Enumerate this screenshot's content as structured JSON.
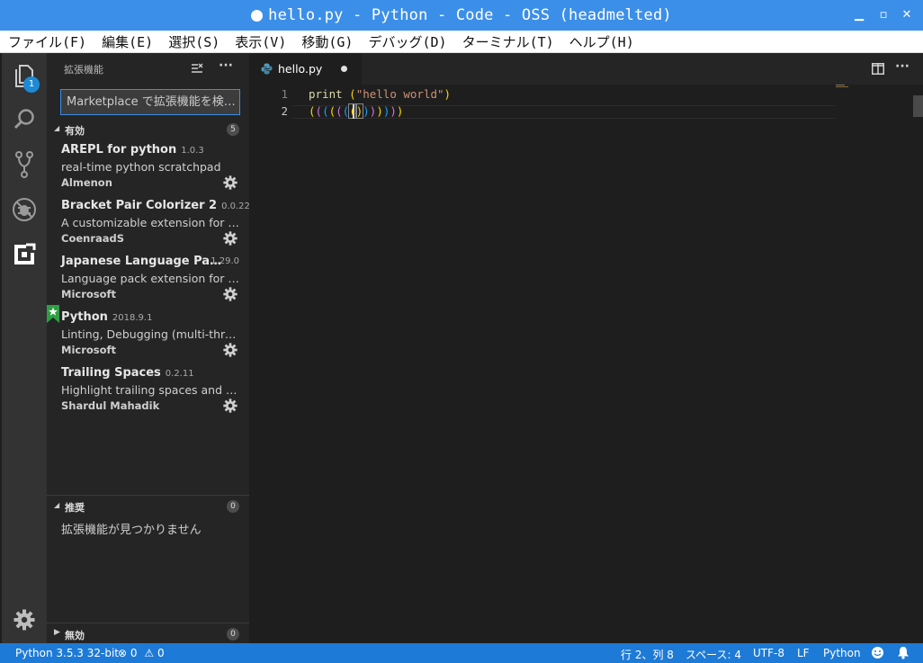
{
  "window": {
    "title": "hello.py - Python - Code - OSS (headmelted)"
  },
  "menu": [
    "ファイル(F)",
    "編集(E)",
    "選択(S)",
    "表示(V)",
    "移動(G)",
    "デバッグ(D)",
    "ターミナル(T)",
    "ヘルプ(H)"
  ],
  "activity": {
    "explorer_badge": "1"
  },
  "sidebar": {
    "title": "拡張機能",
    "search_placeholder": "Marketplace で拡張機能を検…",
    "enabled": {
      "label": "有効",
      "count": "5"
    },
    "extensions": [
      {
        "name": "AREPL for python",
        "version": "1.0.3",
        "description": "real-time python scratchpad",
        "publisher": "Almenon"
      },
      {
        "name": "Bracket Pair Colorizer 2",
        "version": "0.0.22",
        "description": "A customizable extension for colorizing matching brackets",
        "publisher": "CoenraadS"
      },
      {
        "name": "Japanese Language Pa…",
        "version": "1.29.0",
        "description": "Language pack extension for Japanese",
        "publisher": "Microsoft"
      },
      {
        "name": "Python",
        "version": "2018.9.1",
        "description": "Linting, Debugging (multi-threaded, remote)",
        "publisher": "Microsoft"
      },
      {
        "name": "Trailing Spaces",
        "version": "0.2.11",
        "description": "Highlight trailing spaces and delete them",
        "publisher": "Shardul Mahadik"
      }
    ],
    "recommended": {
      "label": "推奨",
      "count": "0",
      "empty_text": "拡張機能が見つかりません"
    },
    "disabled": {
      "label": "無効",
      "count": "0"
    }
  },
  "editor": {
    "tab_label": "hello.py",
    "line_numbers": [
      "1",
      "2"
    ],
    "line1": {
      "fn": "print",
      "open": "(",
      "str": "\"hello world\"",
      "close": ")"
    },
    "line2": [
      "(",
      "(",
      "(",
      "(",
      "(",
      "(",
      "(",
      ")",
      ")",
      ")",
      ")",
      ")",
      ")",
      ")"
    ]
  },
  "status": {
    "interpreter": "Python 3.5.3 32-bit",
    "errors": "0",
    "warnings": "0",
    "position": "行 2、列 8",
    "spaces": "スペース: 4",
    "encoding": "UTF-8",
    "eol": "LF",
    "language": "Python"
  },
  "colors": {
    "accent": "#3c8fe8",
    "status_bar": "#1d7ad6",
    "bracket_gold": "#ffd700",
    "bracket_orchid": "#da70d6",
    "bracket_blue": "#179fff",
    "python_star": "#2ea043"
  }
}
